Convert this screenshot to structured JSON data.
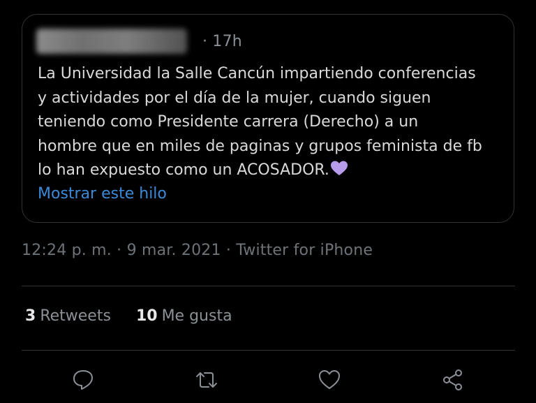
{
  "quoted_tweet": {
    "time_ago": "· 17h",
    "text": "La Universidad la Salle Cancún impartiendo conferencias\ny actividades por el día de la mujer, cuando siguen\nteniendo como Presidente carrera (Derecho) a un\nhombre que en miles de paginas y grupos feminista de fb\nlo han expuesto como un ACOSADOR.",
    "emoji": "purple-heart",
    "show_thread": "Mostrar este hilo"
  },
  "tweet_meta": {
    "time": "12:24 p. m.",
    "separator": " · ",
    "date": "9 mar. 2021",
    "source": "Twitter for iPhone"
  },
  "stats": {
    "retweets_count": "3",
    "retweets_label": "Retweets",
    "likes_count": "10",
    "likes_label": "Me gusta"
  },
  "actions": [
    {
      "icon": "reply-icon"
    },
    {
      "icon": "retweet-icon"
    },
    {
      "icon": "heart-icon"
    },
    {
      "icon": "share-icon"
    }
  ],
  "colors": {
    "background": "#000000",
    "text": "#d9d9d9",
    "muted": "#8b9096",
    "link": "#3b8ad9",
    "border": "#2f3336",
    "emoji": "#b69cea"
  }
}
